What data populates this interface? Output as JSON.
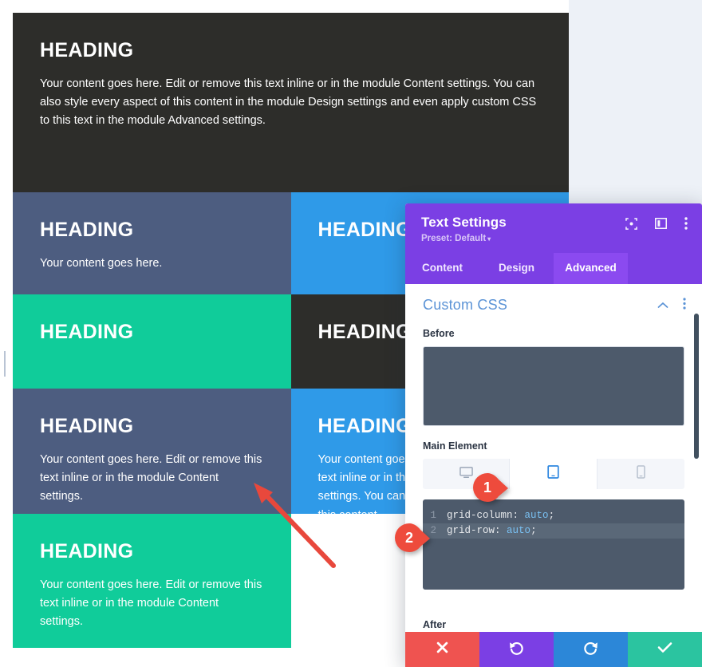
{
  "page": {
    "grid": {
      "rows": [
        {
          "cells": [
            {
              "color_name": "dark",
              "color": "#2d2d2a",
              "heading": "HEADING",
              "body": "Your content goes here. Edit or remove this text inline or in the module Content settings. You can also style every aspect of this content in the module Design settings and even apply custom CSS to this text in the module Advanced settings."
            }
          ]
        },
        {
          "cells": [
            {
              "color_name": "slate",
              "color": "#4d5d80",
              "heading": "HEADING",
              "body": "Your content goes here."
            },
            {
              "color_name": "blue",
              "color": "#2f9ae8",
              "heading": "HEADING",
              "body": ""
            }
          ]
        },
        {
          "cells": [
            {
              "color_name": "teal",
              "color": "#10cc9a",
              "heading": "HEADING",
              "body": ""
            },
            {
              "color_name": "dark",
              "color": "#2d2d2a",
              "heading": "HEADING",
              "body": ""
            }
          ]
        },
        {
          "cells": [
            {
              "color_name": "slate",
              "color": "#4d5d80",
              "heading": "HEADING",
              "body": "Your content goes here. Edit or remove this text inline or in the module Content settings."
            },
            {
              "color_name": "blue",
              "color": "#2f9ae8",
              "heading": "HEADING",
              "body": "Your content goes here. Edit or remove this text inline or in the module Content settings. You can also style every aspect of this content."
            }
          ]
        },
        {
          "cells": [
            {
              "color_name": "teal",
              "color": "#10cc9a",
              "heading": "HEADING",
              "body": "Your content goes here. Edit or remove this text inline or in the module Content settings."
            }
          ]
        }
      ]
    }
  },
  "modal": {
    "title": "Text Settings",
    "preset": "Preset: Default",
    "preset_caret": "▾",
    "header_icons": [
      "focus-icon",
      "layout-panel-icon",
      "kebab-menu-icon"
    ],
    "tabs": [
      {
        "label": "Content",
        "active": false
      },
      {
        "label": "Design",
        "active": false
      },
      {
        "label": "Advanced",
        "active": true
      }
    ],
    "section": {
      "title": "Custom CSS",
      "collapse_icon": "chevron-up-icon",
      "menu_icon": "kebab-menu-icon"
    },
    "before_field": {
      "label": "Before",
      "value": ""
    },
    "main_element": {
      "label": "Main Element",
      "devices": [
        {
          "name": "desktop",
          "icon": "desktop-icon",
          "active": false
        },
        {
          "name": "tablet",
          "icon": "tablet-icon",
          "active": true
        },
        {
          "name": "phone",
          "icon": "phone-icon",
          "active": false
        }
      ],
      "code_lines": [
        {
          "number": "1",
          "property": "grid-column",
          "colon": ":",
          "value": "auto",
          "semicolon": ";",
          "current": false
        },
        {
          "number": "2",
          "property": "grid-row",
          "colon": ":",
          "value": "auto",
          "semicolon": ";",
          "current": true
        }
      ]
    },
    "after_field": {
      "label": "After"
    },
    "footer_buttons": [
      {
        "name": "close",
        "icon": "x-icon",
        "color": "#ef5350"
      },
      {
        "name": "undo",
        "icon": "undo-icon",
        "color": "#7b3fe4"
      },
      {
        "name": "redo",
        "icon": "redo-icon",
        "color": "#2c87d8"
      },
      {
        "name": "save",
        "icon": "check-icon",
        "color": "#2bc4a0"
      }
    ]
  },
  "annotations": {
    "markers": [
      {
        "number": "1"
      },
      {
        "number": "2"
      }
    ],
    "arrow_color": "#e8483c"
  },
  "theme": {
    "accent_purple": "#7b3fe4",
    "accent_purple_active": "#8b4af0",
    "section_blue": "#5b93d6",
    "editor_bg": "#4d5a6b",
    "page_bg": "#edf1f7",
    "marker_red": "#ef5350"
  }
}
